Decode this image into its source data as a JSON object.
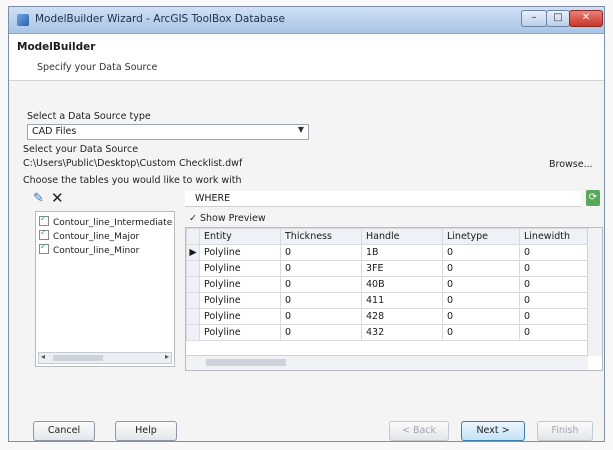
{
  "window": {
    "title": "ModelBuilder Wizard - ArcGIS ToolBox Database",
    "minimize_label": "–",
    "maximize_label": "□",
    "close_label": "✕"
  },
  "header": {
    "title": "ModelBuilder",
    "subtitle": "Specify your Data Source"
  },
  "source_type": {
    "label": "Select a Data Source type",
    "selected": "CAD Files"
  },
  "data_source": {
    "label": "Select your Data Source",
    "path": "C:\\Users\\Public\\Desktop\\Custom Checklist.dwf",
    "browse_label": "Browse..."
  },
  "layers": {
    "label": "Choose the tables you would like to work with",
    "where_prefix": "WHERE",
    "items": [
      {
        "label": "Contour_line_Intermediate",
        "checked": true
      },
      {
        "label": "Contour_line_Major",
        "checked": true
      },
      {
        "label": "Contour_line_Minor",
        "checked": true
      }
    ]
  },
  "preview": {
    "toggle_label": "✓ Show Preview",
    "columns": [
      "Entity",
      "Thickness",
      "Handle",
      "Linetype",
      "Linewidth"
    ],
    "rows": [
      [
        "Polyline",
        "0",
        "1B",
        "0",
        "0"
      ],
      [
        "Polyline",
        "0",
        "3FE",
        "0",
        "0"
      ],
      [
        "Polyline",
        "0",
        "40B",
        "0",
        "0"
      ],
      [
        "Polyline",
        "0",
        "411",
        "0",
        "0"
      ],
      [
        "Polyline",
        "0",
        "428",
        "0",
        "0"
      ],
      [
        "Polyline",
        "0",
        "432",
        "0",
        "0"
      ]
    ]
  },
  "footer": {
    "cancel": "Cancel",
    "help": "Help",
    "back": "< Back",
    "next": "Next >",
    "finish": "Finish"
  },
  "icons": {
    "app": "app-icon",
    "select_all": "edit-icon",
    "clear": "delete-icon",
    "refresh": "refresh-icon"
  }
}
